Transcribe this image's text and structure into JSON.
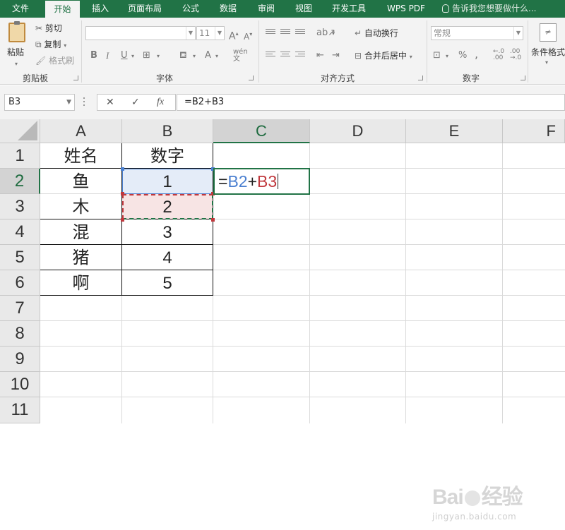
{
  "menu": {
    "tabs": [
      "文件",
      "开始",
      "插入",
      "页面布局",
      "公式",
      "数据",
      "审阅",
      "视图",
      "开发工具",
      "WPS PDF"
    ],
    "active": "开始",
    "tell_me": "告诉我您想要做什么..."
  },
  "ribbon": {
    "clipboard": {
      "label": "剪贴板",
      "paste": "粘贴",
      "cut": "剪切",
      "copy": "复制",
      "format_painter": "格式刷"
    },
    "font": {
      "label": "字体",
      "font_name": "",
      "font_size": "11",
      "bold": "B",
      "italic": "I",
      "underline": "U",
      "grow": "A",
      "shrink": "A",
      "color": "A"
    },
    "alignment": {
      "label": "对齐方式",
      "wrap_text": "自动换行",
      "merge_center": "合并后居中"
    },
    "number": {
      "label": "数字",
      "format": "常规",
      "percent": "%",
      "comma": ","
    },
    "styles": {
      "conditional": "条件格式"
    }
  },
  "formula_bar": {
    "name_box": "B3",
    "cancel": "✕",
    "enter": "✓",
    "fx": "fx",
    "formula": "=B2+B3"
  },
  "grid": {
    "columns": [
      "A",
      "B",
      "C",
      "D",
      "E",
      "F"
    ],
    "rows": [
      "1",
      "2",
      "3",
      "4",
      "5",
      "6",
      "7",
      "8",
      "9",
      "10",
      "11"
    ],
    "selected_column": "C",
    "selected_row": "2",
    "header": {
      "a": "姓名",
      "b": "数字"
    },
    "data": [
      {
        "a": "鱼",
        "b": "1"
      },
      {
        "a": "木",
        "b": "2"
      },
      {
        "a": "混",
        "b": "3"
      },
      {
        "a": "猪",
        "b": "4"
      },
      {
        "a": "啊",
        "b": "5"
      }
    ],
    "editing_cell": {
      "eq": "=",
      "ref1": "B2",
      "plus": "+",
      "ref2": "B3",
      "ref1_color": "#4a7fd0",
      "ref2_color": "#c0383d"
    }
  },
  "watermark": {
    "logo_left": "Bai",
    "logo_right": "经验",
    "url": "jingyan.baidu.com"
  },
  "colors": {
    "brand": "#217346",
    "ribbon_bg": "#f3f3f3",
    "header_bg": "#e9e9e9"
  }
}
